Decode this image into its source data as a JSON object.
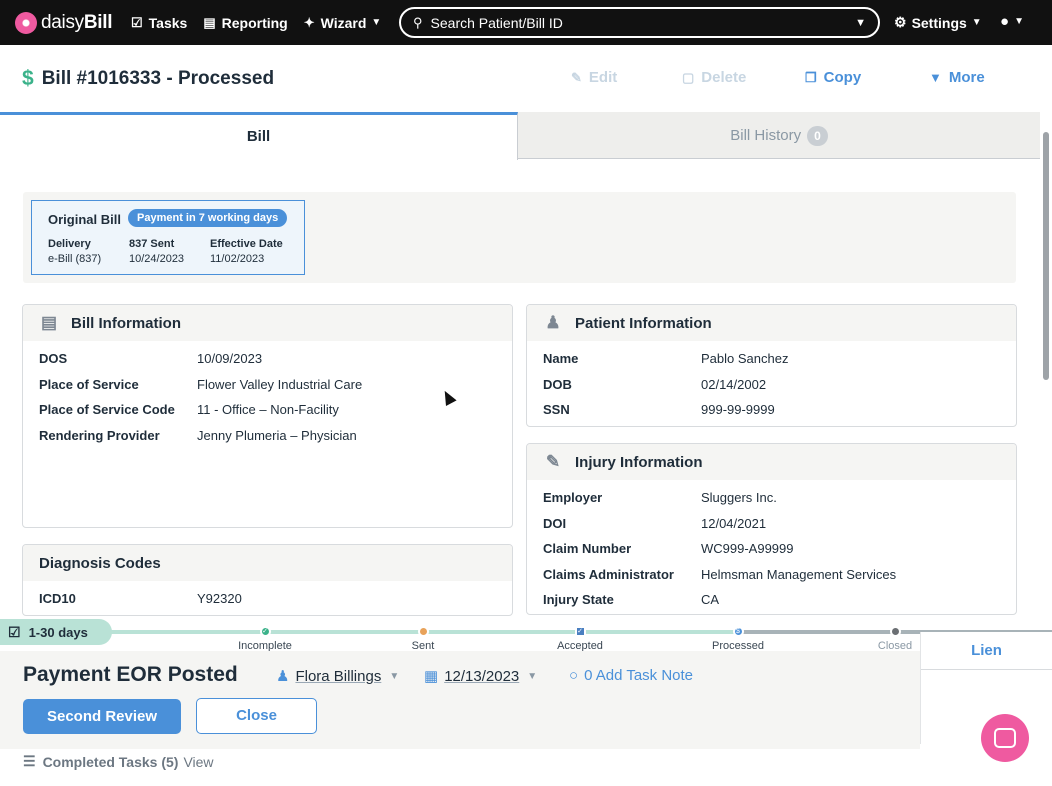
{
  "nav": {
    "brand_prefix": "daisy",
    "brand_suffix": "Bill",
    "tasks": "Tasks",
    "reporting": "Reporting",
    "wizard": "Wizard",
    "search_placeholder": "Search Patient/Bill ID",
    "settings": "Settings"
  },
  "header": {
    "title": "Bill #1016333 - Processed",
    "edit": "Edit",
    "delete": "Delete",
    "copy": "Copy",
    "more": "More"
  },
  "tabs": {
    "bill": "Bill",
    "history": "Bill History",
    "history_count": "0"
  },
  "original_bill": {
    "title": "Original Bill",
    "badge": "Payment in 7 working days",
    "cols": [
      {
        "label": "Delivery",
        "value": "e-Bill (837)"
      },
      {
        "label": "837 Sent",
        "value": "10/24/2023"
      },
      {
        "label": "Effective Date",
        "value": "11/02/2023"
      }
    ]
  },
  "bill_info": {
    "title": "Bill Information",
    "rows": [
      {
        "k": "DOS",
        "v": "10/09/2023"
      },
      {
        "k": "Place of Service",
        "v": "Flower Valley Industrial Care"
      },
      {
        "k": "Place of Service Code",
        "v": "11 - Office – Non-Facility"
      },
      {
        "k": "Rendering Provider",
        "v": "Jenny Plumeria – Physician"
      }
    ]
  },
  "diagnosis": {
    "title": "Diagnosis Codes",
    "rows": [
      {
        "k": "ICD10",
        "v": "Y92320"
      }
    ]
  },
  "patient": {
    "title": "Patient Information",
    "rows": [
      {
        "k": "Name",
        "v": "Pablo Sanchez"
      },
      {
        "k": "DOB",
        "v": "02/14/2002"
      },
      {
        "k": "SSN",
        "v": "999-99-9999"
      }
    ]
  },
  "injury": {
    "title": "Injury Information",
    "rows": [
      {
        "k": "Employer",
        "v": "Sluggers Inc."
      },
      {
        "k": "DOI",
        "v": "12/04/2021"
      },
      {
        "k": "Claim Number",
        "v": "WC999-A99999"
      },
      {
        "k": "Claims Administrator",
        "v": "Helmsman Management Services"
      },
      {
        "k": "Injury State",
        "v": "CA"
      }
    ]
  },
  "workflow": {
    "stage": "1-30 days",
    "steps": [
      "Incomplete",
      "Sent",
      "Accepted",
      "Processed",
      "Closed"
    ],
    "colors": {
      "incomplete": "#3bb28a",
      "sent": "#e8a25a",
      "accepted": "#4a7fc1",
      "processed": "#4a90d9",
      "closed": "#6b6f73"
    }
  },
  "task": {
    "title": "Payment EOR Posted",
    "assignee": "Flora Billings",
    "date": "12/13/2023",
    "note": "0 Add Task Note",
    "primary": "Second Review",
    "secondary": "Close"
  },
  "lien": "Lien",
  "completed": {
    "label": "Completed Tasks (5)",
    "view": "View"
  }
}
